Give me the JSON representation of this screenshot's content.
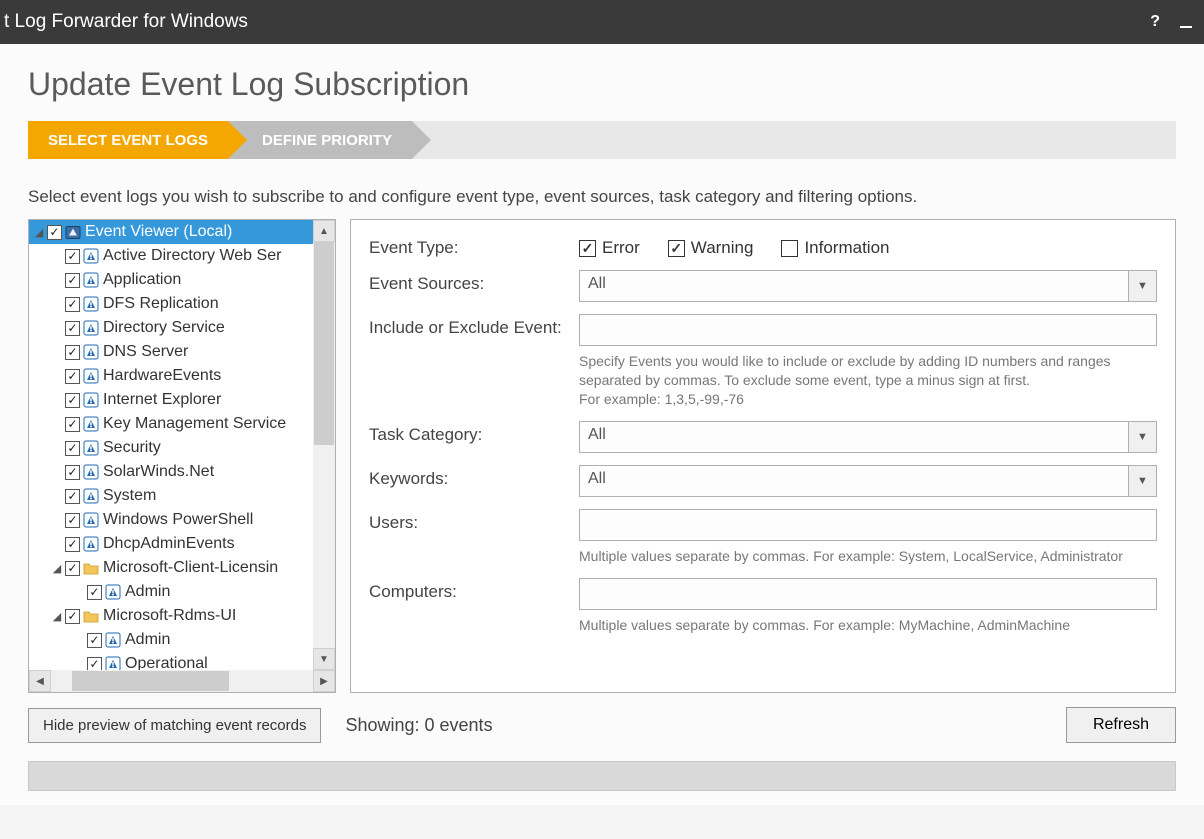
{
  "window": {
    "title": "t Log Forwarder for Windows"
  },
  "page": {
    "heading": "Update Event Log Subscription",
    "steps": {
      "active": "SELECT EVENT LOGS",
      "inactive": "DEFINE PRIORITY"
    },
    "instruction": "Select event logs you wish to subscribe to and configure event type, event sources, task category and filtering options."
  },
  "tree": {
    "root": "Event Viewer (Local)",
    "items": [
      {
        "label": "Active Directory Web Ser",
        "type": "log"
      },
      {
        "label": "Application",
        "type": "log"
      },
      {
        "label": "DFS Replication",
        "type": "log"
      },
      {
        "label": "Directory Service",
        "type": "log"
      },
      {
        "label": "DNS Server",
        "type": "log"
      },
      {
        "label": "HardwareEvents",
        "type": "log"
      },
      {
        "label": "Internet Explorer",
        "type": "log"
      },
      {
        "label": "Key Management Service",
        "type": "log"
      },
      {
        "label": "Security",
        "type": "log"
      },
      {
        "label": "SolarWinds.Net",
        "type": "log"
      },
      {
        "label": "System",
        "type": "log"
      },
      {
        "label": "Windows PowerShell",
        "type": "log"
      },
      {
        "label": "DhcpAdminEvents",
        "type": "log"
      },
      {
        "label": "Microsoft-Client-Licensin",
        "type": "folder",
        "children": [
          {
            "label": "Admin",
            "type": "log"
          }
        ]
      },
      {
        "label": "Microsoft-Rdms-UI",
        "type": "folder",
        "children": [
          {
            "label": "Admin",
            "type": "log"
          },
          {
            "label": "Operational",
            "type": "log"
          }
        ]
      }
    ]
  },
  "form": {
    "labels": {
      "event_type": "Event Type:",
      "event_sources": "Event Sources:",
      "include_exclude": "Include or Exclude Event:",
      "task_category": "Task Category:",
      "keywords": "Keywords:",
      "users": "Users:",
      "computers": "Computers:"
    },
    "event_type": {
      "error": {
        "label": "Error",
        "checked": true
      },
      "warning": {
        "label": "Warning",
        "checked": true
      },
      "information": {
        "label": "Information",
        "checked": false
      }
    },
    "event_sources": "All",
    "include_exclude": "",
    "include_hint": "Specify Events you would like to include or exclude by adding ID numbers and ranges separated by commas. To exclude some event, type a minus sign at first.\nFor example: 1,3,5,-99,-76",
    "task_category": "All",
    "keywords": "All",
    "users": "",
    "users_hint": "Multiple values separate by commas. For example: System, LocalService, Administrator",
    "computers": "",
    "computers_hint": "Multiple values separate by commas. For example: MyMachine, AdminMachine"
  },
  "bottom": {
    "hide_preview": "Hide preview of matching event records",
    "showing": "Showing: 0 events",
    "refresh": "Refresh"
  }
}
